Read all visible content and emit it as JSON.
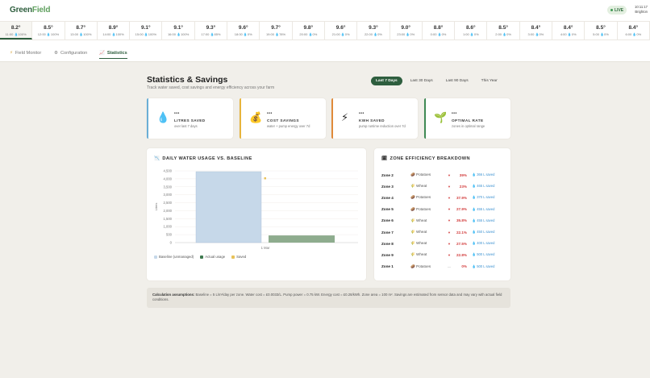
{
  "header": {
    "logo_part1": "Green",
    "logo_part2": "Field",
    "live_label": "LIVE",
    "time": "10:11:17",
    "location": "Brighton"
  },
  "hours": [
    {
      "temp": "8.2°",
      "time": "11:00",
      "precip": "100%"
    },
    {
      "temp": "8.5°",
      "time": "12:00",
      "precip": "100%"
    },
    {
      "temp": "8.7°",
      "time": "13:00",
      "precip": "100%"
    },
    {
      "temp": "8.9°",
      "time": "14:00",
      "precip": "100%"
    },
    {
      "temp": "9.1°",
      "time": "15:00",
      "precip": "100%"
    },
    {
      "temp": "9.1°",
      "time": "16:00",
      "precip": "100%"
    },
    {
      "temp": "9.3°",
      "time": "17:00",
      "precip": "85%"
    },
    {
      "temp": "9.6°",
      "time": "18:00",
      "precip": "0%"
    },
    {
      "temp": "9.7°",
      "time": "19:00",
      "precip": "78%"
    },
    {
      "temp": "9.8°",
      "time": "20:00",
      "precip": "0%"
    },
    {
      "temp": "9.6°",
      "time": "21:00",
      "precip": "0%"
    },
    {
      "temp": "9.3°",
      "time": "22:00",
      "precip": "0%"
    },
    {
      "temp": "9.0°",
      "time": "23:00",
      "precip": "0%"
    },
    {
      "temp": "8.8°",
      "time": "0:00",
      "precip": "0%"
    },
    {
      "temp": "8.6°",
      "time": "1:00",
      "precip": "0%"
    },
    {
      "temp": "8.5°",
      "time": "2:00",
      "precip": "0%"
    },
    {
      "temp": "8.4°",
      "time": "3:00",
      "precip": "0%"
    },
    {
      "temp": "8.4°",
      "time": "4:00",
      "precip": "0%"
    },
    {
      "temp": "8.5°",
      "time": "5:00",
      "precip": "0%"
    },
    {
      "temp": "8.4°",
      "time": "6:00",
      "precip": "0%"
    }
  ],
  "nav": {
    "field_monitor": "Field Monitor",
    "configuration": "Configuration",
    "statistics": "Statistics"
  },
  "page": {
    "title": "Statistics & Savings",
    "subtitle": "Track water saved, cost savings and energy efficiency across your farm"
  },
  "ranges": [
    "Last 7 Days",
    "Last 30 Days",
    "Last 90 Days",
    "This Year"
  ],
  "cards": [
    {
      "icon": "💧",
      "value": "•••",
      "label": "LITRES SAVED",
      "sub": "over last 7 days",
      "color": "#6aaed6"
    },
    {
      "icon": "💰",
      "value": "•••",
      "label": "COST SAVINGS",
      "sub": "water + pump energy over 7d",
      "color": "#e7b43c"
    },
    {
      "icon": "⚡",
      "value": "•••",
      "label": "KWH SAVED",
      "sub": "pump runtime reduction over 7d",
      "color": "#e08a3a"
    },
    {
      "icon": "🌱",
      "value": "•••",
      "label": "OPTIMAL RATE",
      "sub": "zones in optimal range",
      "color": "#3f8a55"
    }
  ],
  "chart_panel": {
    "title": "DAILY WATER USAGE VS. BASELINE",
    "legend": [
      "Baseline (unmanaged)",
      "Actual usage",
      "Saved"
    ]
  },
  "chart_data": {
    "type": "bar",
    "categories": [
      "1 Mar"
    ],
    "ylabel": "Litres",
    "ylim": [
      0,
      4500
    ],
    "yticks": [
      "0",
      "500",
      "1,000",
      "1,500",
      "2,000",
      "2,500",
      "3,000",
      "3,500",
      "4,000",
      "4,500"
    ],
    "series": [
      {
        "name": "Baseline (unmanaged)",
        "values": [
          4450
        ],
        "color": "#c6d8e9"
      },
      {
        "name": "Actual usage",
        "values": [
          450
        ],
        "color": "#8eac8e"
      },
      {
        "name": "Saved",
        "values": [
          4000
        ],
        "color": "#e8c25a"
      }
    ]
  },
  "zones_panel": {
    "title": "ZONE EFFICIENCY BREAKDOWN",
    "rows": [
      {
        "zone": "Zone 2",
        "crop_icon": "🥔",
        "crop": "Potatoes",
        "arrow": "▼",
        "pct": "39%",
        "saved": "💧 366 L saved"
      },
      {
        "zone": "Zone 3",
        "crop_icon": "🌾",
        "crop": "Wheat",
        "arrow": "▼",
        "pct": "23%",
        "saved": "💧 465 L saved"
      },
      {
        "zone": "Zone 4",
        "crop_icon": "🥔",
        "crop": "Potatoes",
        "arrow": "▼",
        "pct": "37.9%",
        "saved": "💧 370 L saved"
      },
      {
        "zone": "Zone 5",
        "crop_icon": "🥔",
        "crop": "Potatoes",
        "arrow": "▼",
        "pct": "27.9%",
        "saved": "💧 455 L saved"
      },
      {
        "zone": "Zone 6",
        "crop_icon": "🌾",
        "crop": "Wheat",
        "arrow": "▼",
        "pct": "35.8%",
        "saved": "💧 455 L saved"
      },
      {
        "zone": "Zone 7",
        "crop_icon": "🌾",
        "crop": "Wheat",
        "arrow": "▼",
        "pct": "22.1%",
        "saved": "💧 450 L saved"
      },
      {
        "zone": "Zone 8",
        "crop_icon": "🌾",
        "crop": "Wheat",
        "arrow": "▼",
        "pct": "27.5%",
        "saved": "💧 400 L saved"
      },
      {
        "zone": "Zone 9",
        "crop_icon": "🌾",
        "crop": "Wheat",
        "arrow": "▼",
        "pct": "22.8%",
        "saved": "💧 500 L saved"
      },
      {
        "zone": "Zone 1",
        "crop_icon": "🥔",
        "crop": "Potatoes",
        "arrow": "—",
        "pct": "0%",
        "saved": "💧 500 L saved"
      }
    ]
  },
  "note": {
    "label": "Calculation assumptions:",
    "text": "Baseline = 5 L/m²/day per zone. Water cost = £0.0033/L. Pump power = 0.75 kW. Energy cost = £0.28/kWh. Zone area = 100 m². Savings are estimated from sensor data and may vary with actual field conditions."
  }
}
